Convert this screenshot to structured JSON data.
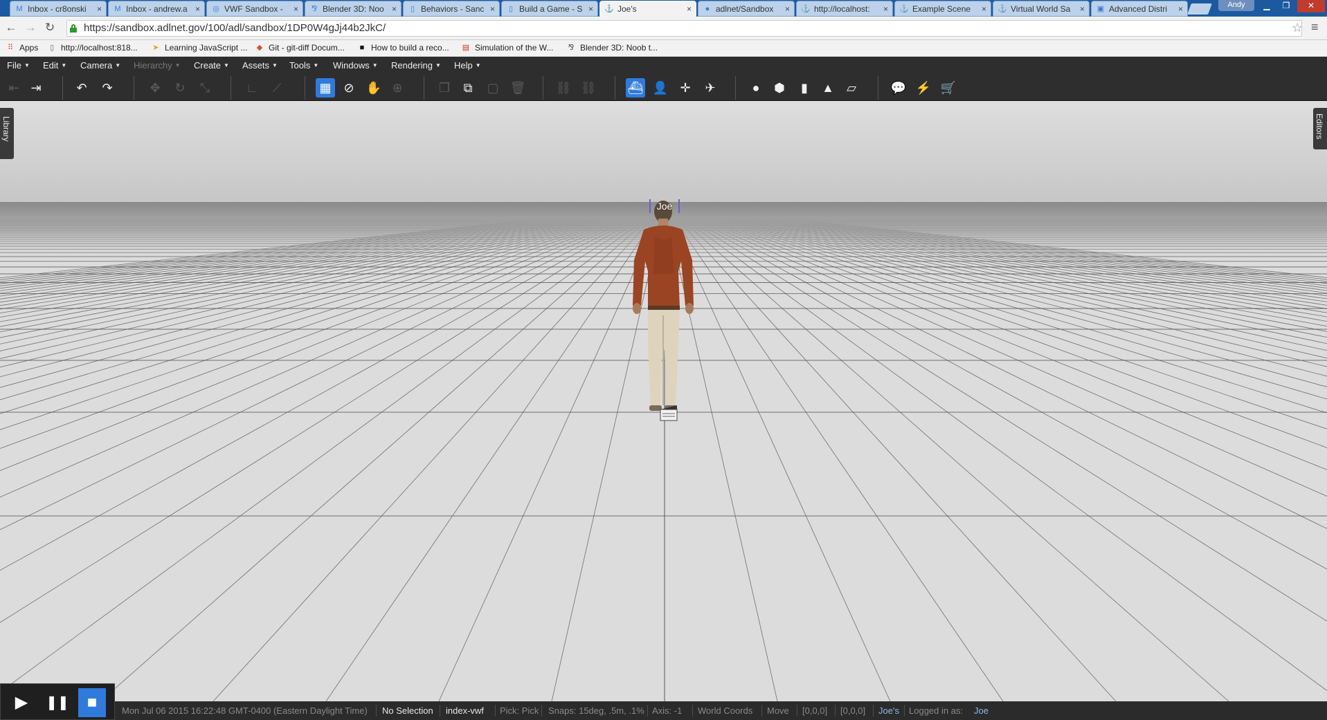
{
  "browser": {
    "tabs": [
      {
        "label": "Inbox - cr8onski",
        "icon": "gmail-icon",
        "icon_glyph": "M"
      },
      {
        "label": "Inbox - andrew.a",
        "icon": "gmail-icon",
        "icon_glyph": "M"
      },
      {
        "label": "VWF Sandbox -",
        "icon": "globe-icon",
        "icon_glyph": "◎"
      },
      {
        "label": "Blender 3D: Noo",
        "icon": "wikibooks-icon",
        "icon_glyph": "⅋"
      },
      {
        "label": "Behaviors - Sanc",
        "icon": "page-icon",
        "icon_glyph": "▯"
      },
      {
        "label": "Build a Game - S",
        "icon": "page-icon",
        "icon_glyph": "▯"
      },
      {
        "label": "Joe's",
        "icon": "sandbox-icon",
        "icon_glyph": "⚓"
      },
      {
        "label": "adlnet/Sandbox",
        "icon": "github-icon",
        "icon_glyph": "●"
      },
      {
        "label": "http://localhost:",
        "icon": "sandbox-icon",
        "icon_glyph": "⚓"
      },
      {
        "label": "Example Scene",
        "icon": "sandbox-icon",
        "icon_glyph": "⚓"
      },
      {
        "label": "Virtual World Sa",
        "icon": "sandbox-icon",
        "icon_glyph": "⚓"
      },
      {
        "label": "Advanced Distri",
        "icon": "adl-icon",
        "icon_glyph": "▣"
      }
    ],
    "tab_close_glyph": "×",
    "user": "Andy",
    "url": "https://sandbox.adlnet.gov/100/adl/sandbox/1DP0W4gJj44b2JkC/",
    "bookmarks": [
      {
        "label": "Apps",
        "icon": "apps-grid-icon",
        "glyph": "⠿",
        "color": "#d04a3b"
      },
      {
        "label": "http://localhost:818...",
        "icon": "page-icon",
        "glyph": "▯",
        "color": "#666666"
      },
      {
        "label": "Learning JavaScript ...",
        "icon": "bookmark-arrow-icon",
        "glyph": "➤",
        "color": "#e0a020"
      },
      {
        "label": "Git - git-diff Docum...",
        "icon": "git-icon",
        "glyph": "◆",
        "color": "#e24c2c"
      },
      {
        "label": "How to build a reco...",
        "icon": "blackbox-icon",
        "glyph": "■",
        "color": "#111111"
      },
      {
        "label": "Simulation of the W...",
        "icon": "pdf-icon",
        "glyph": "▤",
        "color": "#d0322a"
      },
      {
        "label": "Blender 3D: Noob t...",
        "icon": "wikibooks-icon",
        "glyph": "⅋",
        "color": "#444444"
      }
    ]
  },
  "menubar": [
    {
      "label": "File",
      "enabled": true
    },
    {
      "label": "Edit",
      "enabled": true
    },
    {
      "label": "Camera",
      "enabled": true
    },
    {
      "label": "Hierarchy",
      "enabled": false
    },
    {
      "label": "Create",
      "enabled": true
    },
    {
      "label": "Assets",
      "enabled": true
    },
    {
      "label": "Tools",
      "enabled": true
    },
    {
      "label": "Windows",
      "enabled": true
    },
    {
      "label": "Rendering",
      "enabled": true
    },
    {
      "label": "Help",
      "enabled": true
    }
  ],
  "toolbar": {
    "tools": [
      {
        "name": "logout-icon",
        "glyph": "⇤",
        "state": "dim"
      },
      {
        "name": "login-icon",
        "glyph": "⇥",
        "state": "normal"
      },
      {
        "name": "undo-icon",
        "glyph": "↶",
        "state": "normal"
      },
      {
        "name": "redo-icon",
        "glyph": "↷",
        "state": "normal"
      },
      {
        "name": "move-icon",
        "glyph": "✥",
        "state": "dim"
      },
      {
        "name": "rotate-icon",
        "glyph": "↻",
        "state": "dim"
      },
      {
        "name": "scale-icon",
        "glyph": "⤡",
        "state": "dim"
      },
      {
        "name": "local-axis-icon",
        "glyph": "∟",
        "state": "dim"
      },
      {
        "name": "world-axis-icon",
        "glyph": "⟋",
        "state": "dim"
      },
      {
        "name": "pick-grid-icon",
        "glyph": "▦",
        "state": "on"
      },
      {
        "name": "no-select-icon",
        "glyph": "⊘",
        "state": "normal"
      },
      {
        "name": "hand-icon",
        "glyph": "✋",
        "state": "dim"
      },
      {
        "name": "crosshair-icon",
        "glyph": "⊕",
        "state": "dim"
      },
      {
        "name": "copy-icon",
        "glyph": "❐",
        "state": "dim"
      },
      {
        "name": "duplicate-icon",
        "glyph": "⧉",
        "state": "normal"
      },
      {
        "name": "paste-icon",
        "glyph": "▢",
        "state": "dim"
      },
      {
        "name": "delete-icon",
        "glyph": "🗑",
        "state": "dim"
      },
      {
        "name": "link-icon",
        "glyph": "⛓",
        "state": "dim"
      },
      {
        "name": "unlink-icon",
        "glyph": "⛓",
        "state": "dim"
      },
      {
        "name": "navigate-icon",
        "glyph": "⛴",
        "state": "on"
      },
      {
        "name": "avatar-icon",
        "glyph": "👤",
        "state": "normal"
      },
      {
        "name": "fly-icon",
        "glyph": "✛",
        "state": "normal"
      },
      {
        "name": "orbit-icon",
        "glyph": "✈",
        "state": "normal"
      },
      {
        "name": "sphere-icon",
        "glyph": "●",
        "state": "normal"
      },
      {
        "name": "cube-icon",
        "glyph": "⬢",
        "state": "normal"
      },
      {
        "name": "cylinder-icon",
        "glyph": "▮",
        "state": "normal"
      },
      {
        "name": "cone-icon",
        "glyph": "▲",
        "state": "normal"
      },
      {
        "name": "plane-icon",
        "glyph": "▱",
        "state": "normal"
      },
      {
        "name": "chat-icon",
        "glyph": "💬",
        "state": "normal"
      },
      {
        "name": "lightning-icon",
        "glyph": "⚡",
        "state": "dim"
      },
      {
        "name": "cart-icon",
        "glyph": "🛒",
        "state": "normal"
      }
    ]
  },
  "viewport": {
    "library_tab": "Library",
    "editors_tab": "Editors",
    "avatar_name": "Joe",
    "sky_color": "#d4d4d4",
    "floor_color": "#dcdcdc",
    "grid_color": "#4a4a4a"
  },
  "playback": {
    "play_icon": "▶",
    "pause_icon": "❚❚",
    "stop_icon": "■"
  },
  "statusbar": {
    "datetime": "Mon Jul 06 2015 16:22:48 GMT-0400 (Eastern Daylight Time)",
    "selection": "No Selection",
    "index": "index-vwf",
    "pick": "Pick: Pick",
    "snaps": "Snaps: 15deg, .5m, .1%",
    "axis": "Axis: -1",
    "coords": "World Coords",
    "mode": "Move",
    "pos1": "[0,0,0]",
    "pos2": "[0,0,0]",
    "world": "Joe's",
    "logged_label": "Logged in as:",
    "user": "Joe"
  }
}
